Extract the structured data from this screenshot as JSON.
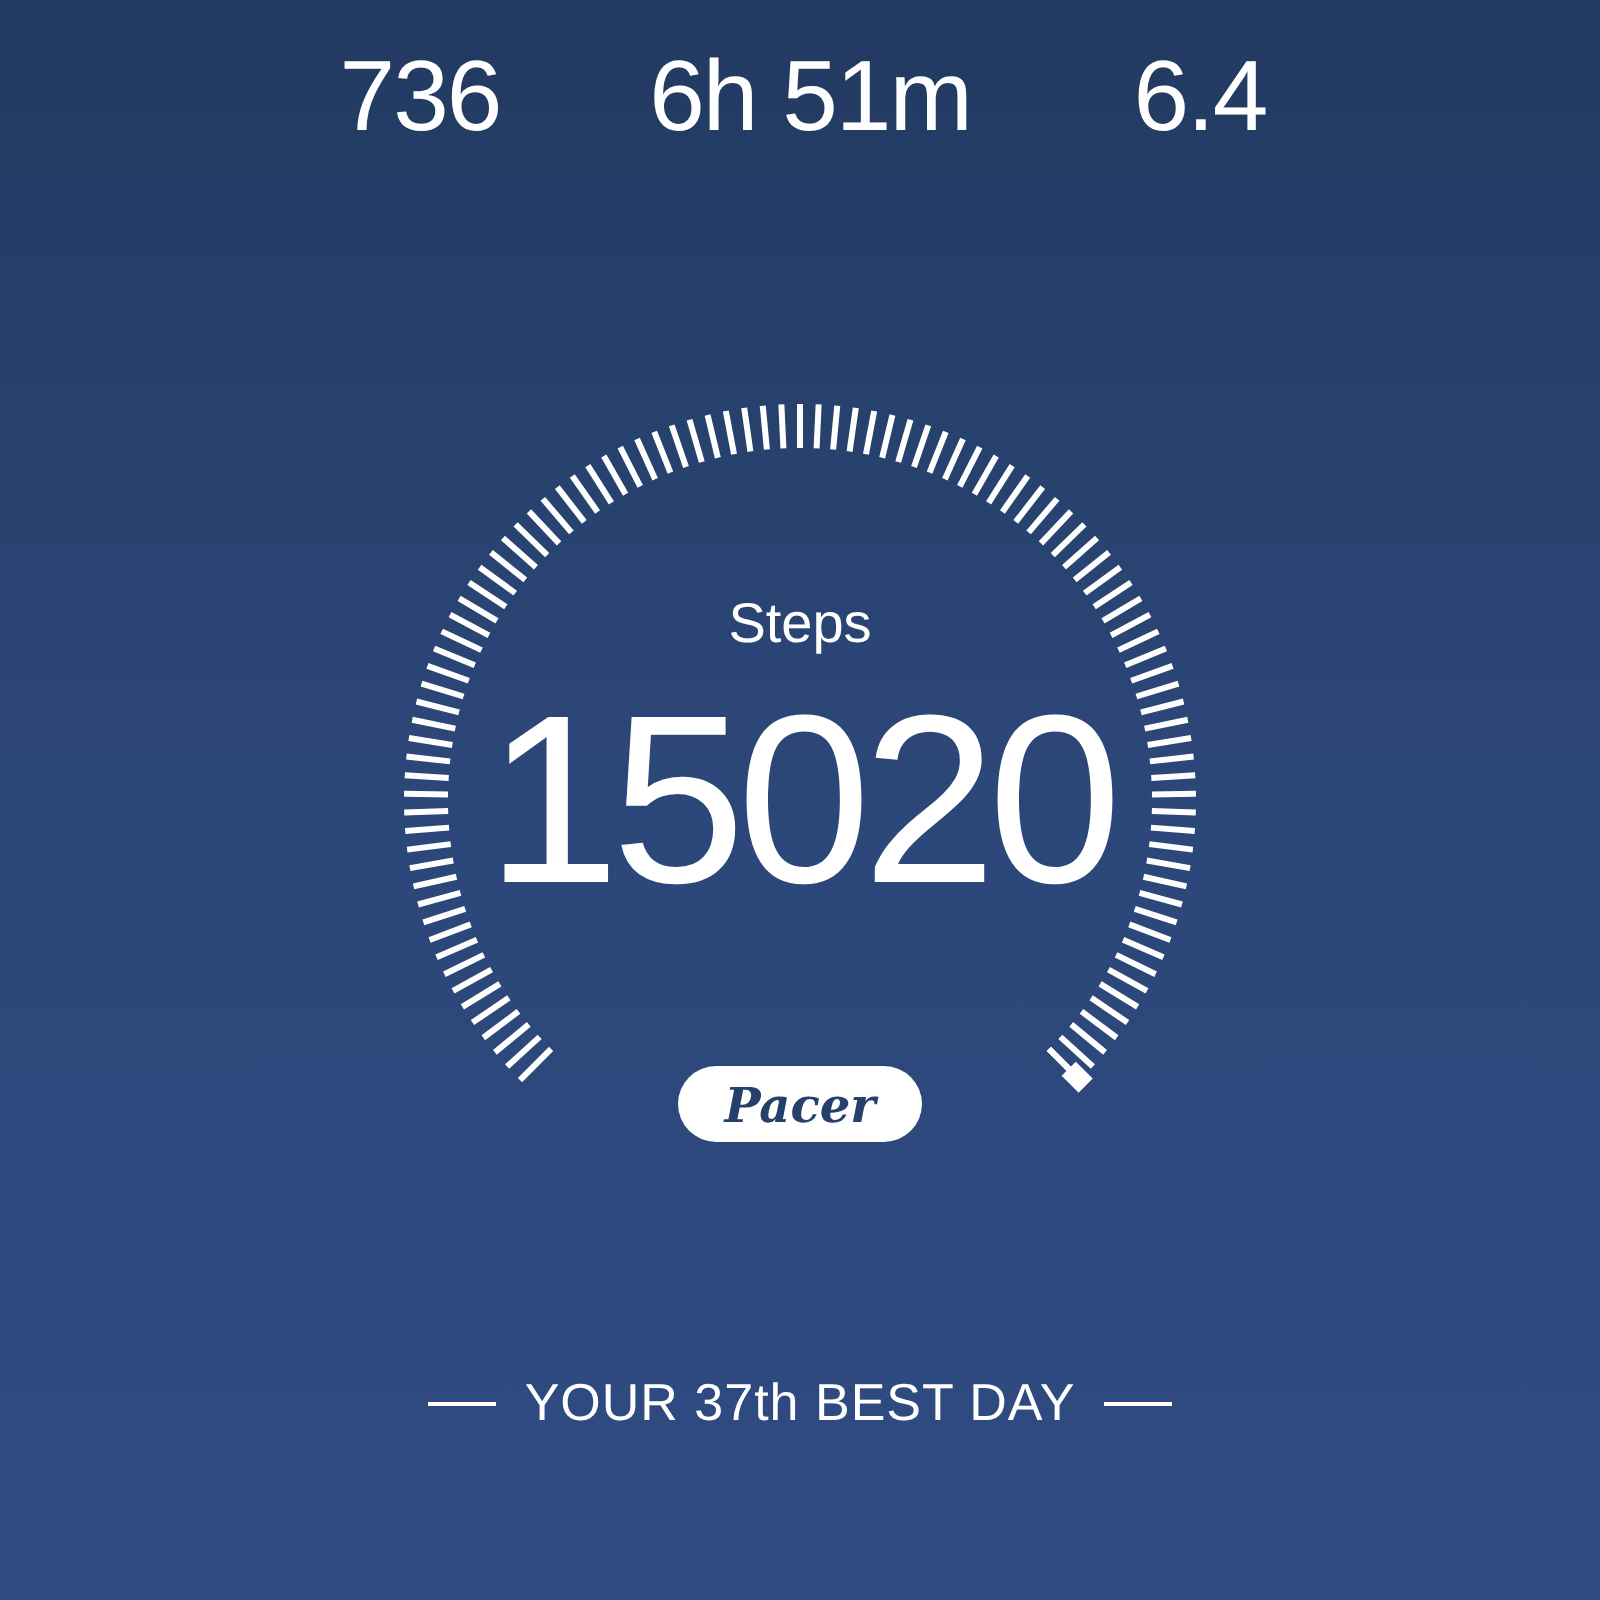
{
  "stats": [
    {
      "value": "736"
    },
    {
      "value": "6h 51m"
    },
    {
      "value": "6.4"
    }
  ],
  "gauge": {
    "label": "Steps",
    "value": "15020",
    "brand": "Pacer"
  },
  "footer": "YOUR 37th BEST DAY"
}
